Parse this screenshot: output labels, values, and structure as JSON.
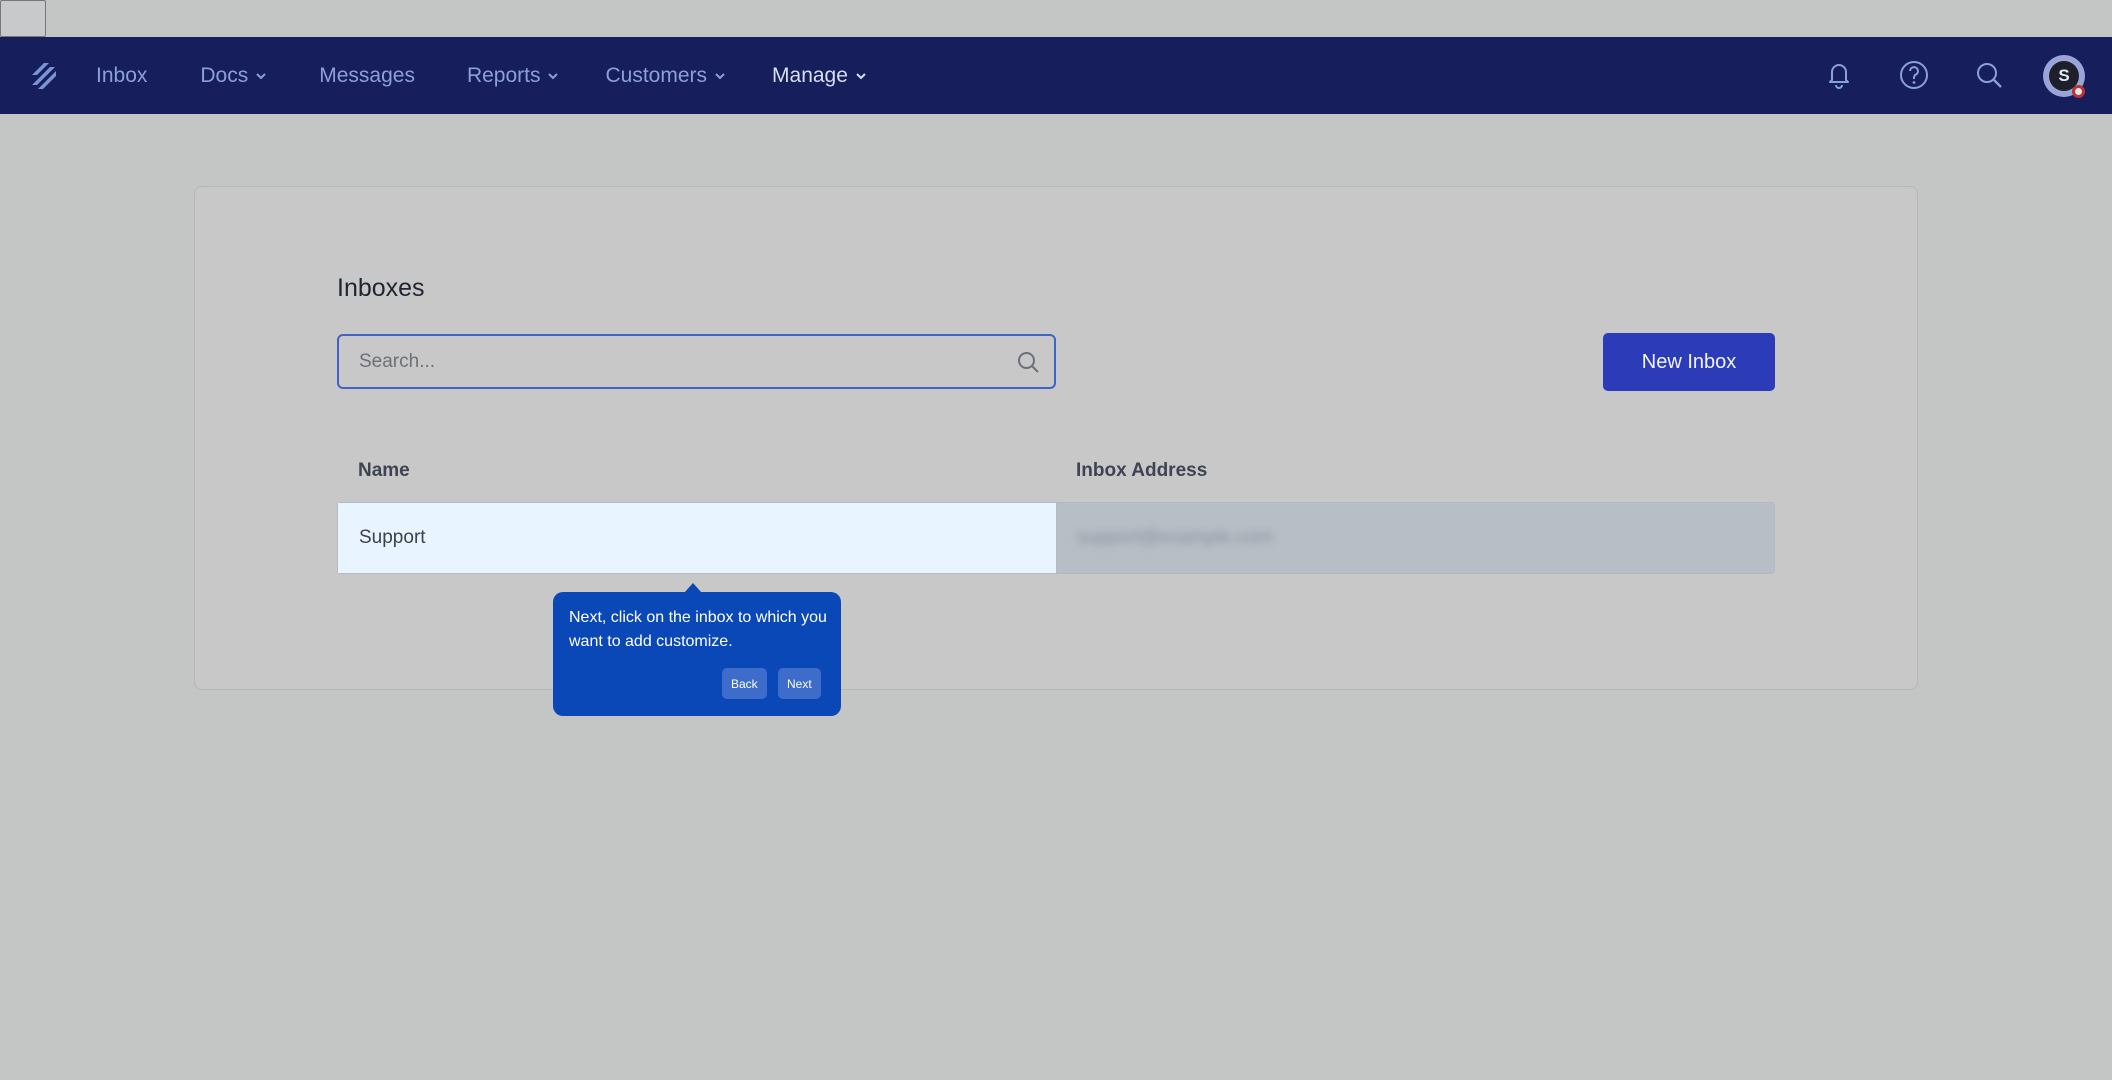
{
  "nav": {
    "items": [
      {
        "label": "Inbox",
        "dropdown": false,
        "active": false
      },
      {
        "label": "Docs",
        "dropdown": true,
        "active": false
      },
      {
        "label": "Messages",
        "dropdown": false,
        "active": false
      },
      {
        "label": "Reports",
        "dropdown": true,
        "active": false
      },
      {
        "label": "Customers",
        "dropdown": true,
        "active": false
      },
      {
        "label": "Manage",
        "dropdown": true,
        "active": true
      }
    ],
    "avatar_initial": "S",
    "icons": [
      "bell-icon",
      "help-icon",
      "search-icon"
    ]
  },
  "main": {
    "title": "Inboxes",
    "search_placeholder": "Search...",
    "new_button_label": "New Inbox",
    "columns": [
      "Name",
      "Inbox Address"
    ],
    "rows": [
      {
        "name": "Support",
        "address": "support@example.com"
      }
    ]
  },
  "tooltip": {
    "text": "Next, click on the inbox to which you want to add customize.",
    "back_label": "Back",
    "next_label": "Next"
  },
  "colors": {
    "navbar": "#161e5c",
    "primary_button": "#2c3cb8",
    "tooltip": "#0b48b7",
    "highlight_row": "#e8f4ff"
  }
}
